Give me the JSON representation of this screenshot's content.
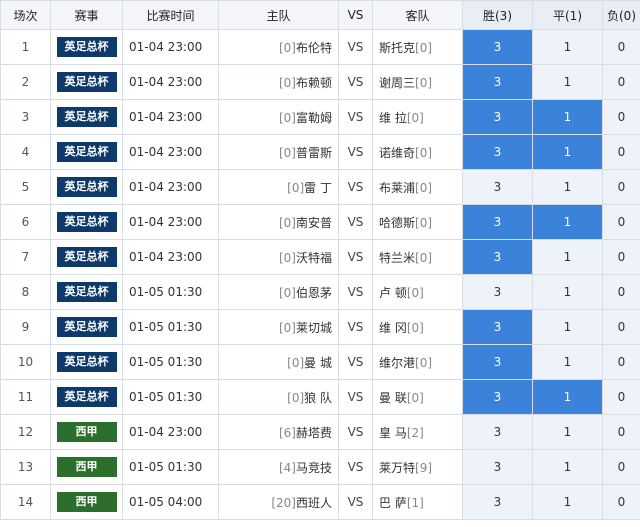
{
  "headers": {
    "index": "场次",
    "league": "赛事",
    "time": "比赛时间",
    "home": "主队",
    "vs": "VS",
    "away": "客队",
    "win": "胜(3)",
    "draw": "平(1)",
    "loss": "负(0)"
  },
  "colors": {
    "league_fa_cup": "#0d3a6b",
    "league_la_liga": "#2c6e2c",
    "selected": "#3b82db"
  },
  "rows": [
    {
      "index": "1",
      "league": "英足总杯",
      "league_color": "#0d3a6b",
      "time": "01-04 23:00",
      "home_rank": "[0]",
      "home": "布伦特",
      "vs": "VS",
      "away": "斯托克",
      "away_rank": "[0]",
      "win": "3",
      "draw": "1",
      "loss": "0",
      "sel_win": true,
      "sel_draw": false,
      "sel_loss": false
    },
    {
      "index": "2",
      "league": "英足总杯",
      "league_color": "#0d3a6b",
      "time": "01-04 23:00",
      "home_rank": "[0]",
      "home": "布赖顿",
      "vs": "VS",
      "away": "谢周三",
      "away_rank": "[0]",
      "win": "3",
      "draw": "1",
      "loss": "0",
      "sel_win": true,
      "sel_draw": false,
      "sel_loss": false
    },
    {
      "index": "3",
      "league": "英足总杯",
      "league_color": "#0d3a6b",
      "time": "01-04 23:00",
      "home_rank": "[0]",
      "home": "富勒姆",
      "vs": "VS",
      "away": "维 拉",
      "away_rank": "[0]",
      "win": "3",
      "draw": "1",
      "loss": "0",
      "sel_win": true,
      "sel_draw": true,
      "sel_loss": false
    },
    {
      "index": "4",
      "league": "英足总杯",
      "league_color": "#0d3a6b",
      "time": "01-04 23:00",
      "home_rank": "[0]",
      "home": "普雷斯",
      "vs": "VS",
      "away": "诺维奇",
      "away_rank": "[0]",
      "win": "3",
      "draw": "1",
      "loss": "0",
      "sel_win": true,
      "sel_draw": true,
      "sel_loss": false
    },
    {
      "index": "5",
      "league": "英足总杯",
      "league_color": "#0d3a6b",
      "time": "01-04 23:00",
      "home_rank": "[0]",
      "home": "雷 丁",
      "vs": "VS",
      "away": "布莱浦",
      "away_rank": "[0]",
      "win": "3",
      "draw": "1",
      "loss": "0",
      "sel_win": false,
      "sel_draw": false,
      "sel_loss": false
    },
    {
      "index": "6",
      "league": "英足总杯",
      "league_color": "#0d3a6b",
      "time": "01-04 23:00",
      "home_rank": "[0]",
      "home": "南安普",
      "vs": "VS",
      "away": "哈德斯",
      "away_rank": "[0]",
      "win": "3",
      "draw": "1",
      "loss": "0",
      "sel_win": true,
      "sel_draw": true,
      "sel_loss": false
    },
    {
      "index": "7",
      "league": "英足总杯",
      "league_color": "#0d3a6b",
      "time": "01-04 23:00",
      "home_rank": "[0]",
      "home": "沃特福",
      "vs": "VS",
      "away": "特兰米",
      "away_rank": "[0]",
      "win": "3",
      "draw": "1",
      "loss": "0",
      "sel_win": true,
      "sel_draw": false,
      "sel_loss": false
    },
    {
      "index": "8",
      "league": "英足总杯",
      "league_color": "#0d3a6b",
      "time": "01-05 01:30",
      "home_rank": "[0]",
      "home": "伯恩茅",
      "vs": "VS",
      "away": "卢 顿",
      "away_rank": "[0]",
      "win": "3",
      "draw": "1",
      "loss": "0",
      "sel_win": false,
      "sel_draw": false,
      "sel_loss": false
    },
    {
      "index": "9",
      "league": "英足总杯",
      "league_color": "#0d3a6b",
      "time": "01-05 01:30",
      "home_rank": "[0]",
      "home": "莱切城",
      "vs": "VS",
      "away": "维 冈",
      "away_rank": "[0]",
      "win": "3",
      "draw": "1",
      "loss": "0",
      "sel_win": true,
      "sel_draw": false,
      "sel_loss": false
    },
    {
      "index": "10",
      "league": "英足总杯",
      "league_color": "#0d3a6b",
      "time": "01-05 01:30",
      "home_rank": "[0]",
      "home": "曼 城",
      "vs": "VS",
      "away": "维尔港",
      "away_rank": "[0]",
      "win": "3",
      "draw": "1",
      "loss": "0",
      "sel_win": true,
      "sel_draw": false,
      "sel_loss": false
    },
    {
      "index": "11",
      "league": "英足总杯",
      "league_color": "#0d3a6b",
      "time": "01-05 01:30",
      "home_rank": "[0]",
      "home": "狼 队",
      "vs": "VS",
      "away": "曼 联",
      "away_rank": "[0]",
      "win": "3",
      "draw": "1",
      "loss": "0",
      "sel_win": true,
      "sel_draw": true,
      "sel_loss": false
    },
    {
      "index": "12",
      "league": "西甲",
      "league_color": "#2c6e2c",
      "time": "01-04 23:00",
      "home_rank": "[6]",
      "home": "赫塔费",
      "vs": "VS",
      "away": "皇 马",
      "away_rank": "[2]",
      "win": "3",
      "draw": "1",
      "loss": "0",
      "sel_win": false,
      "sel_draw": false,
      "sel_loss": false
    },
    {
      "index": "13",
      "league": "西甲",
      "league_color": "#2c6e2c",
      "time": "01-05 01:30",
      "home_rank": "[4]",
      "home": "马竞技",
      "vs": "VS",
      "away": "莱万特",
      "away_rank": "[9]",
      "win": "3",
      "draw": "1",
      "loss": "0",
      "sel_win": false,
      "sel_draw": false,
      "sel_loss": false
    },
    {
      "index": "14",
      "league": "西甲",
      "league_color": "#2c6e2c",
      "time": "01-05 04:00",
      "home_rank": "[20]",
      "home": "西班人",
      "vs": "VS",
      "away": "巴 萨",
      "away_rank": "[1]",
      "win": "3",
      "draw": "1",
      "loss": "0",
      "sel_win": false,
      "sel_draw": false,
      "sel_loss": false
    }
  ]
}
